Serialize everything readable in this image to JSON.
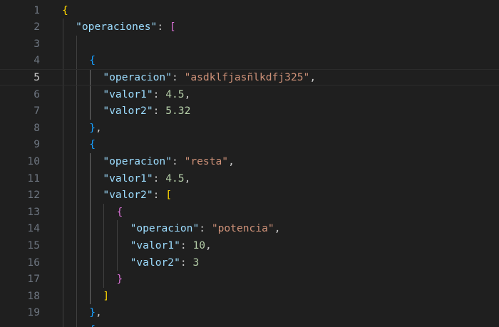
{
  "editor": {
    "language": "json",
    "active_line": 5,
    "lines": [
      {
        "n": "1",
        "indent": 0,
        "tokens": [
          {
            "t": "{",
            "c": "b1"
          }
        ]
      },
      {
        "n": "2",
        "indent": 1,
        "tokens": [
          {
            "t": "\"operaciones\"",
            "c": "key"
          },
          {
            "t": ": ",
            "c": "punc"
          },
          {
            "t": "[",
            "c": "b2"
          }
        ]
      },
      {
        "n": "3",
        "indent": 0,
        "tokens": []
      },
      {
        "n": "4",
        "indent": 2,
        "tokens": [
          {
            "t": "{",
            "c": "b3"
          }
        ]
      },
      {
        "n": "5",
        "indent": 3,
        "tokens": [
          {
            "t": "\"operacion\"",
            "c": "key"
          },
          {
            "t": ": ",
            "c": "punc"
          },
          {
            "t": "\"asdklfjasñlkdfj325\"",
            "c": "str"
          },
          {
            "t": ",",
            "c": "punc"
          }
        ]
      },
      {
        "n": "6",
        "indent": 3,
        "tokens": [
          {
            "t": "\"valor1\"",
            "c": "key"
          },
          {
            "t": ": ",
            "c": "punc"
          },
          {
            "t": "4.5",
            "c": "num"
          },
          {
            "t": ",",
            "c": "punc"
          }
        ]
      },
      {
        "n": "7",
        "indent": 3,
        "tokens": [
          {
            "t": "\"valor2\"",
            "c": "key"
          },
          {
            "t": ": ",
            "c": "punc"
          },
          {
            "t": "5.32",
            "c": "num"
          }
        ]
      },
      {
        "n": "8",
        "indent": 2,
        "tokens": [
          {
            "t": "}",
            "c": "b3"
          },
          {
            "t": ",",
            "c": "punc"
          }
        ]
      },
      {
        "n": "9",
        "indent": 2,
        "tokens": [
          {
            "t": "{",
            "c": "b3"
          }
        ]
      },
      {
        "n": "10",
        "indent": 3,
        "tokens": [
          {
            "t": "\"operacion\"",
            "c": "key"
          },
          {
            "t": ": ",
            "c": "punc"
          },
          {
            "t": "\"resta\"",
            "c": "str"
          },
          {
            "t": ",",
            "c": "punc"
          }
        ]
      },
      {
        "n": "11",
        "indent": 3,
        "tokens": [
          {
            "t": "\"valor1\"",
            "c": "key"
          },
          {
            "t": ": ",
            "c": "punc"
          },
          {
            "t": "4.5",
            "c": "num"
          },
          {
            "t": ",",
            "c": "punc"
          }
        ]
      },
      {
        "n": "12",
        "indent": 3,
        "tokens": [
          {
            "t": "\"valor2\"",
            "c": "key"
          },
          {
            "t": ": ",
            "c": "punc"
          },
          {
            "t": "[",
            "c": "b1"
          }
        ]
      },
      {
        "n": "13",
        "indent": 4,
        "tokens": [
          {
            "t": "{",
            "c": "b2"
          }
        ]
      },
      {
        "n": "14",
        "indent": 5,
        "tokens": [
          {
            "t": "\"operacion\"",
            "c": "key"
          },
          {
            "t": ": ",
            "c": "punc"
          },
          {
            "t": "\"potencia\"",
            "c": "str"
          },
          {
            "t": ",",
            "c": "punc"
          }
        ]
      },
      {
        "n": "15",
        "indent": 5,
        "tokens": [
          {
            "t": "\"valor1\"",
            "c": "key"
          },
          {
            "t": ": ",
            "c": "punc"
          },
          {
            "t": "10",
            "c": "num"
          },
          {
            "t": ",",
            "c": "punc"
          }
        ]
      },
      {
        "n": "16",
        "indent": 5,
        "tokens": [
          {
            "t": "\"valor2\"",
            "c": "key"
          },
          {
            "t": ": ",
            "c": "punc"
          },
          {
            "t": "3",
            "c": "num"
          }
        ]
      },
      {
        "n": "17",
        "indent": 4,
        "tokens": [
          {
            "t": "}",
            "c": "b2"
          }
        ]
      },
      {
        "n": "18",
        "indent": 3,
        "tokens": [
          {
            "t": "]",
            "c": "b1"
          }
        ]
      },
      {
        "n": "19",
        "indent": 2,
        "tokens": [
          {
            "t": "}",
            "c": "b3"
          },
          {
            "t": ",",
            "c": "punc"
          }
        ]
      },
      {
        "n": "",
        "indent": 2,
        "tokens": [
          {
            "t": "{",
            "c": "b3"
          }
        ]
      }
    ]
  },
  "colors": {
    "background": "#1f1f1f",
    "line_number": "#6e7681",
    "line_number_active": "#cccccc",
    "key": "#9cdcfe",
    "string": "#ce9178",
    "number": "#b5cea8",
    "bracket_level_1": "#ffd700",
    "bracket_level_2": "#da70d6",
    "bracket_level_3": "#179fff"
  }
}
